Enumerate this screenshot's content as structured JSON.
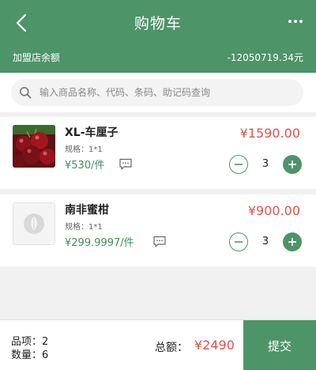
{
  "header": {
    "title": "购物车",
    "balance_label": "加盟店余额",
    "balance_value": "-12050719.34元"
  },
  "search": {
    "placeholder": "输入商品名称、代码、条码、助记码查询"
  },
  "items": [
    {
      "name": "XL-车厘子",
      "spec": "规格：1*1",
      "unit_price": "¥530/件",
      "total_price": "¥1590.00",
      "quantity": "3",
      "thumbnail": "cherries-photo"
    },
    {
      "name": "南非蜜柑",
      "spec": "规格：1*1",
      "unit_price": "¥299.9997/件",
      "total_price": "¥900.00",
      "quantity": "3",
      "thumbnail": "placeholder-logo"
    }
  ],
  "footer": {
    "item_count": "品项：2",
    "quantity_count": "数量：6",
    "total_label": "总额：",
    "total_amount": "¥2490",
    "submit_label": "提交"
  },
  "colors": {
    "primary_green": "#4d9468",
    "price_red": "#e0504a",
    "background": "#f0f0f0"
  },
  "icons": [
    "back-arrow-icon",
    "more-dots-icon",
    "search-icon",
    "message-icon",
    "minus-icon",
    "plus-icon",
    "leaf-logo-icon"
  ]
}
